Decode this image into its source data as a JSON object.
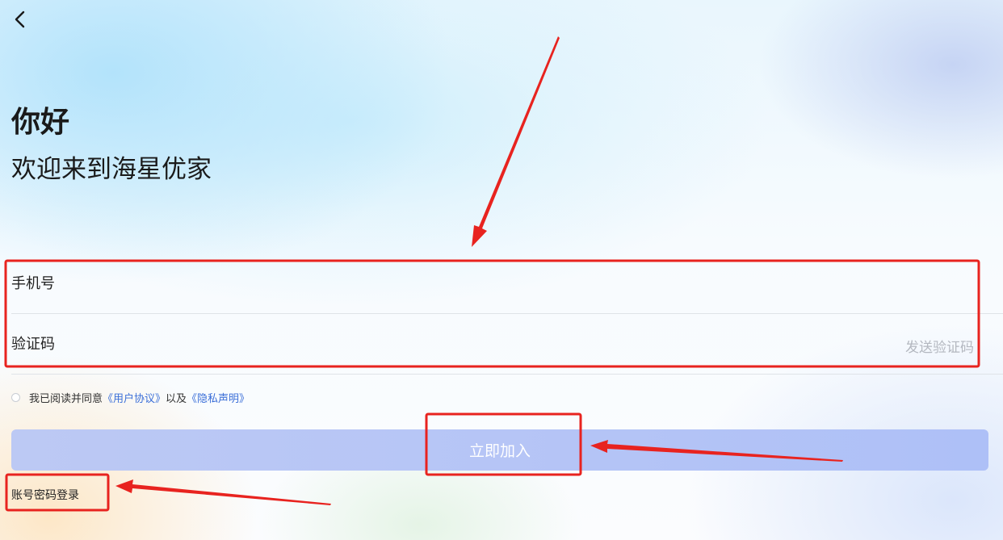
{
  "header": {
    "back_icon": "chevron-left-icon",
    "greeting": "你好",
    "welcome": "欢迎来到海星优家"
  },
  "form": {
    "phone_label": "手机号",
    "code_label": "验证码",
    "send_code_label": "发送验证码"
  },
  "agreement": {
    "prefix": "我已阅读并同意",
    "user_agreement": "《用户协议》",
    "connector": "以及",
    "privacy": "《隐私声明》",
    "checked": false
  },
  "actions": {
    "join_label": "立即加入",
    "password_login_label": "账号密码登录"
  },
  "colors": {
    "annotation_red": "#e8231f",
    "link_blue": "#3b6fd8",
    "button_bg": "#b6c5f6"
  }
}
